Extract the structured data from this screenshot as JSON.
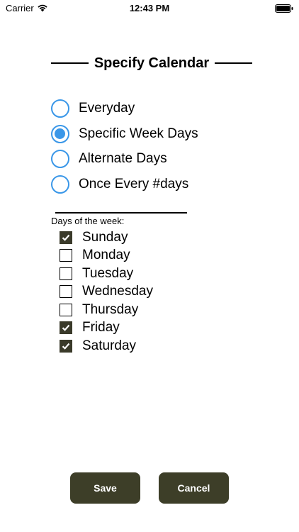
{
  "status_bar": {
    "carrier": "Carrier",
    "time": "12:43 PM",
    "wifi_icon": "wifi-icon",
    "battery_icon": "battery-icon"
  },
  "title": "Specify Calendar",
  "radio_options": [
    {
      "label": "Everyday",
      "selected": false
    },
    {
      "label": "Specific Week Days",
      "selected": true
    },
    {
      "label": "Alternate Days",
      "selected": false
    },
    {
      "label": "Once Every #days",
      "selected": false
    }
  ],
  "days_label": "Days of the week:",
  "days": [
    {
      "label": "Sunday",
      "checked": true
    },
    {
      "label": "Monday",
      "checked": false
    },
    {
      "label": "Tuesday",
      "checked": false
    },
    {
      "label": "Wednesday",
      "checked": false
    },
    {
      "label": "Thursday",
      "checked": false
    },
    {
      "label": "Friday",
      "checked": true
    },
    {
      "label": "Saturday",
      "checked": true
    }
  ],
  "buttons": {
    "save": "Save",
    "cancel": "Cancel"
  },
  "colors": {
    "radio_accent": "#3a97e8",
    "checkbox_fill": "#3a3a2a",
    "button_bg": "#3d3e28",
    "button_text": "#ffffff"
  }
}
